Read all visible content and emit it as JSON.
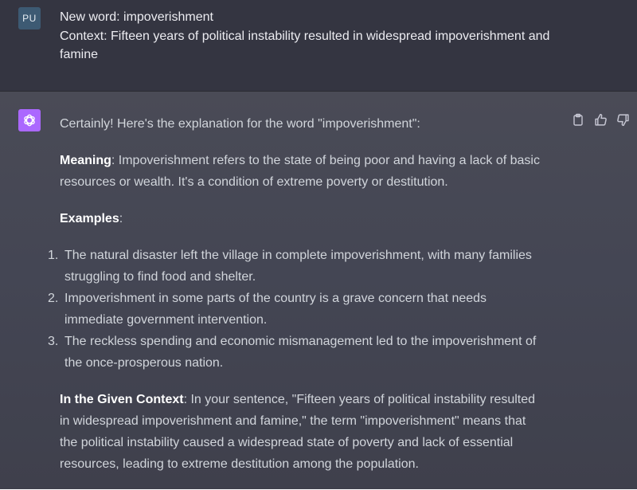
{
  "user": {
    "avatar_initials": "PU",
    "line1": "New word: impoverishment",
    "line2": "Context: Fifteen years of political instability resulted in widespread impoverishment and famine"
  },
  "assistant": {
    "avatar_icon": "openai-logo-icon",
    "intro": "Certainly! Here's the explanation for the word \"impoverishment\":",
    "meaning_label": "Meaning",
    "meaning_text": ": Impoverishment refers to the state of being poor and having a lack of basic resources or wealth. It's a condition of extreme poverty or destitution.",
    "examples_label": "Examples",
    "examples_suffix": ":",
    "examples": [
      {
        "num": "1.",
        "text": "The natural disaster left the village in complete impoverishment, with many families struggling to find food and shelter."
      },
      {
        "num": "2.",
        "text": "Impoverishment in some parts of the country is a grave concern that needs immediate government intervention."
      },
      {
        "num": "3.",
        "text": "The reckless spending and economic mismanagement led to the impoverishment of the once-prosperous nation."
      }
    ],
    "context_label": "In the Given Context",
    "context_text": ": In your sentence, \"Fifteen years of political instability resulted in widespread impoverishment and famine,\" the term \"impoverishment\" means that the political instability caused a widespread state of poverty and lack of essential resources, leading to extreme destitution among the population."
  },
  "actions": {
    "copy_icon": "clipboard-icon",
    "like_icon": "thumbs-up-icon",
    "dislike_icon": "thumbs-down-icon"
  },
  "colors": {
    "user_bg": "#343541",
    "assistant_bg": "#444654",
    "user_avatar": "#3d5a73",
    "bot_avatar": "#ab68ff"
  }
}
